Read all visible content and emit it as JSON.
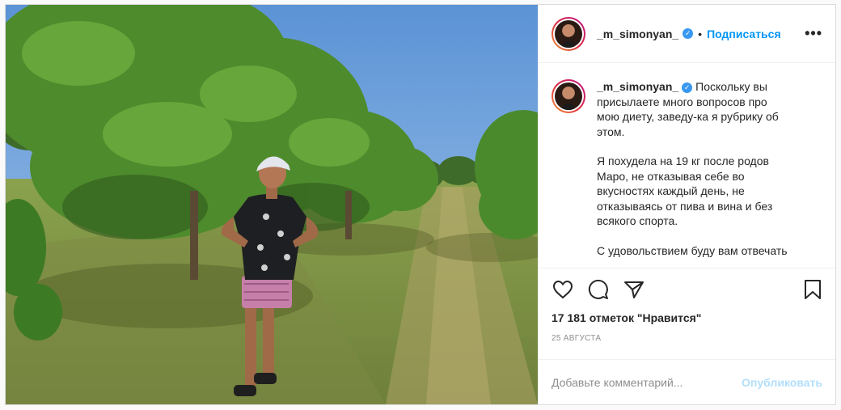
{
  "post": {
    "username": "_m_simonyan_",
    "follow_label": "Подписаться",
    "dot": "•",
    "more_label": "•••",
    "caption_user": "_m_simonyan_",
    "caption_p1": "Поскольку вы присылаете много вопросов про мою диету, заведу-ка я рубрику об этом.",
    "caption_p2": "Я похудела на 19 кг после родов Маро, не отказывая себе во вкусностях каждый день, не отказываясь от пива и вина и без всякого спорта.",
    "caption_p3": "С удовольствием буду вам отвечать",
    "likes": "17 181 отметок \"Нравится\"",
    "date": "25 августа",
    "comment_placeholder": "Добавьте комментарий...",
    "publish_label": "Опубликовать"
  },
  "icons": [
    "heart-icon",
    "comment-icon",
    "share-icon",
    "bookmark-icon",
    "verified-icon",
    "more-options-icon"
  ],
  "colors": {
    "accent": "#0095f6",
    "verified": "#3897f0",
    "publish_disabled": "#b2dffc",
    "muted": "#8e8e8e"
  }
}
